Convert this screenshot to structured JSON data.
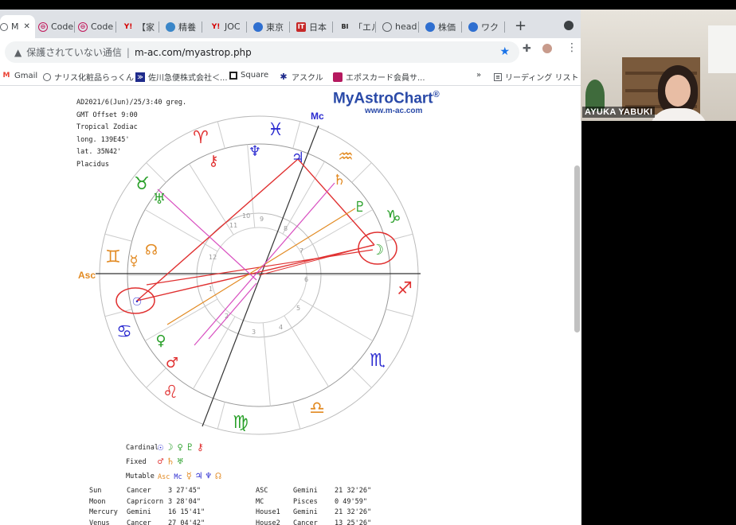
{
  "browser": {
    "tabs": [
      {
        "label": "M",
        "favicon": "chart-favicon",
        "active": true,
        "close": "✕"
      },
      {
        "label": "Code",
        "favicon": "code-favicon"
      },
      {
        "label": "Code",
        "favicon": "code-favicon"
      },
      {
        "label": "【家",
        "favicon": "yahoo-favicon"
      },
      {
        "label": "精養",
        "favicon": "site-favicon"
      },
      {
        "label": "JOC",
        "favicon": "yahoo-favicon"
      },
      {
        "label": "東京",
        "favicon": "site-favicon"
      },
      {
        "label": "日本",
        "favicon": "it-favicon"
      },
      {
        "label": "「エル",
        "favicon": "bi-favicon"
      },
      {
        "label": "head",
        "favicon": "globe-favicon"
      },
      {
        "label": "株価",
        "favicon": "site-favicon"
      },
      {
        "label": "ワク",
        "favicon": "site-favicon"
      }
    ],
    "new_tab": "+",
    "security_text": "保護されていない通信",
    "url": "m-ac.com/myastrop.php",
    "bookmarks": [
      {
        "label": "Gmail",
        "icon": "gmail-icon"
      },
      {
        "label": "ナリス化粧品らっくん",
        "icon": "globe-icon"
      },
      {
        "label": "佐川急便株式会社＜...",
        "icon": "sagawa-icon"
      },
      {
        "label": "Square",
        "icon": "square-icon"
      },
      {
        "label": "アスクル",
        "icon": "askul-icon"
      },
      {
        "label": "エポスカード会員サ...",
        "icon": "epos-icon"
      },
      {
        "label": "»",
        "icon": ""
      },
      {
        "label": "リーディング リスト",
        "icon": "reading-list-icon"
      }
    ]
  },
  "chart_page": {
    "logo": "MyAstroChart",
    "logo_reg": "®",
    "logo_url": "www.m-ac.com",
    "meta": [
      "AD2021/6(Jun)/25/3:40 greg.",
      "GMT Offset 9:00",
      "Tropical Zodiac",
      "long. 139E45'",
      "lat. 35N42'",
      "Placidus"
    ],
    "asc_label": "Asc",
    "mc_label": "Mc",
    "house_numbers": [
      "11",
      "12",
      "1",
      "2",
      "3",
      "4",
      "5",
      "6",
      "7",
      "8",
      "9",
      "10"
    ],
    "signs": [
      {
        "glyph": "♓",
        "color": "#2b2bd0"
      },
      {
        "glyph": "♒",
        "color": "#e28a22"
      },
      {
        "glyph": "♑",
        "color": "#2aa02a"
      },
      {
        "glyph": "♐",
        "color": "#e03030"
      },
      {
        "glyph": "♏",
        "color": "#2b2bd0"
      },
      {
        "glyph": "♎",
        "color": "#e28a22"
      },
      {
        "glyph": "♍",
        "color": "#2aa02a"
      },
      {
        "glyph": "♌",
        "color": "#e03030"
      },
      {
        "glyph": "♋",
        "color": "#2b2bd0"
      },
      {
        "glyph": "♊",
        "color": "#e28a22"
      },
      {
        "glyph": "♉",
        "color": "#2aa02a"
      },
      {
        "glyph": "♈",
        "color": "#e03030"
      }
    ],
    "planets": [
      {
        "glyph": "♆",
        "color": "#2b2bd0",
        "name": "neptune"
      },
      {
        "glyph": "♃",
        "color": "#2b2bd0",
        "name": "jupiter"
      },
      {
        "glyph": "♄",
        "color": "#e28a22",
        "name": "saturn"
      },
      {
        "glyph": "♇",
        "color": "#2aa02a",
        "name": "pluto"
      },
      {
        "glyph": "☽",
        "color": "#2aa02a",
        "name": "moon"
      },
      {
        "glyph": "⚷",
        "color": "#e03030",
        "name": "chiron"
      },
      {
        "glyph": "♅",
        "color": "#2aa02a",
        "name": "uranus"
      },
      {
        "glyph": "☿",
        "color": "#e28a22",
        "name": "mercury"
      },
      {
        "glyph": "☊",
        "color": "#e28a22",
        "name": "node"
      },
      {
        "glyph": "☉",
        "color": "#2b2bd0",
        "name": "sun"
      },
      {
        "glyph": "♀",
        "color": "#2aa02a",
        "name": "venus"
      },
      {
        "glyph": "♂",
        "color": "#e03030",
        "name": "mars"
      }
    ],
    "legend": [
      {
        "label": "Cardinal",
        "glyphs": [
          "☉",
          "☽",
          "♀",
          "♇",
          "⚷"
        ],
        "colors": [
          "#2b2bd0",
          "#2aa02a",
          "#2aa02a",
          "#2aa02a",
          "#e03030"
        ]
      },
      {
        "label": "Fixed",
        "glyphs": [
          "♂",
          "♄",
          "♅"
        ],
        "colors": [
          "#e03030",
          "#e28a22",
          "#2aa02a"
        ]
      },
      {
        "label": "Mutable",
        "glyphs": [
          "Asc",
          "Mc",
          "☿",
          "♃",
          "♆",
          "☊"
        ],
        "colors": [
          "#e28a22",
          "#2b2bd0",
          "#e28a22",
          "#2b2bd0",
          "#2b2bd0",
          "#e28a22"
        ]
      }
    ],
    "table_rows": [
      [
        "Sun",
        "Cancer",
        "3 27'45\"",
        "ASC",
        "Gemini",
        "21 32'26\""
      ],
      [
        "Moon",
        "Capricorn",
        "3 28'04\"",
        "MC",
        "Pisces",
        "0 49'59\""
      ],
      [
        "Mercury",
        "Gemini",
        "16 15'41\"",
        "House1",
        "Gemini",
        "21 32'26\""
      ],
      [
        "Venus",
        "Cancer",
        "27 04'42\"",
        "House2",
        "Cancer",
        "13 25'26\""
      ]
    ]
  },
  "video": {
    "participant_name": "AYUKA YABUKI"
  },
  "colors": {
    "red": "#e03030",
    "orange": "#e28a22",
    "green": "#2aa02a",
    "blue": "#2b2bd0",
    "magenta": "#d84fc0"
  }
}
